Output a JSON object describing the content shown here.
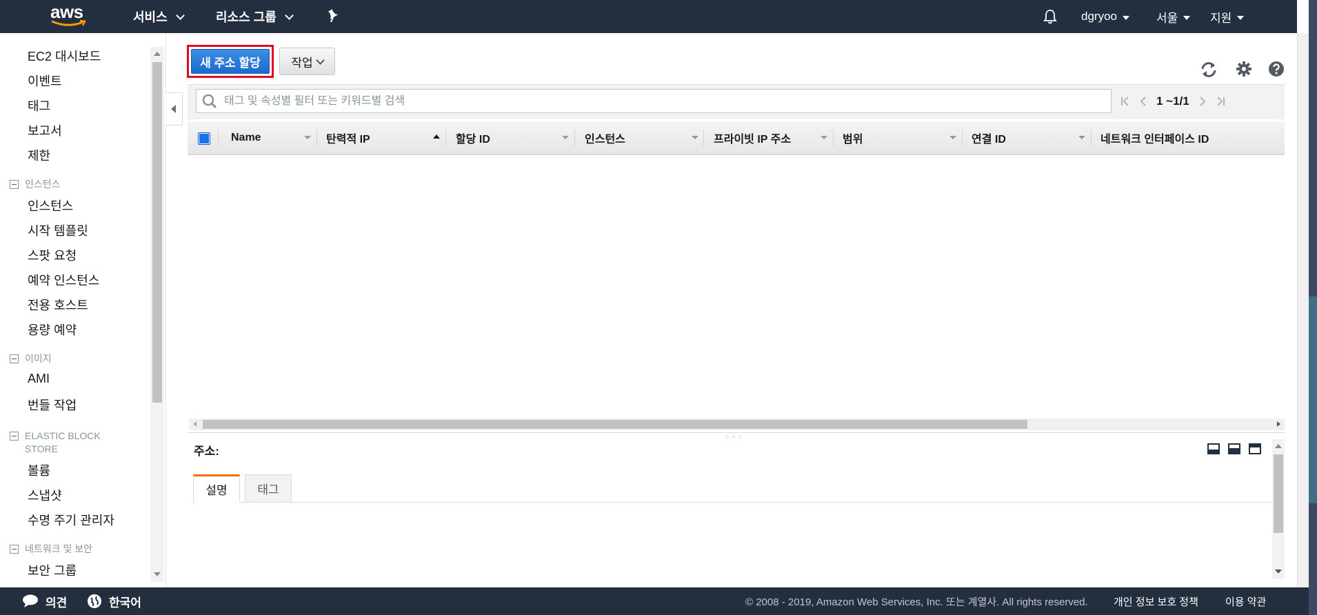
{
  "topnav": {
    "logo": "aws",
    "services": "서비스",
    "resource_groups": "리소스 그룹",
    "pin_icon": "pin-icon",
    "bell_icon": "bell-icon",
    "user": "dgryoo",
    "region": "서울",
    "support": "지원"
  },
  "sidebar": {
    "links_top": [
      "EC2 대시보드",
      "이벤트",
      "태그",
      "보고서",
      "제한"
    ],
    "sections": [
      {
        "title": "인스턴스",
        "items": [
          "인스턴스",
          "시작 템플릿",
          "스팟 요청",
          "예약 인스턴스",
          "전용 호스트",
          "용량 예약"
        ]
      },
      {
        "title": "이미지",
        "items": [
          "AMI",
          "번들 작업"
        ]
      },
      {
        "title": "ELASTIC BLOCK STORE",
        "items": [
          "볼륨",
          "스냅샷",
          "수명 주기 관리자"
        ]
      },
      {
        "title": "네트워크 및 보안",
        "items": [
          "보안 그룹"
        ]
      }
    ]
  },
  "toolbar": {
    "allocate_label": "새 주소 할당",
    "actions_label": "작업",
    "icons": [
      "refresh-icon",
      "gear-icon",
      "help-icon"
    ]
  },
  "filter": {
    "placeholder": "태그 및 속성별 필터 또는 키워드별 검색",
    "pager_count": "1 ~1/1"
  },
  "table": {
    "columns": [
      "Name",
      "탄력적 IP",
      "할당 ID",
      "인스턴스",
      "프라이빗 IP 주소",
      "범위",
      "연결 ID",
      "네트워크 인터페이스 ID"
    ],
    "sorted_column": "탄력적 IP",
    "rows": []
  },
  "details": {
    "title": "주소:",
    "tabs": [
      "설명",
      "태그"
    ],
    "active_tab": "설명"
  },
  "footer": {
    "feedback": "의견",
    "language": "한국어",
    "copyright": "© 2008 - 2019, Amazon Web Services, Inc. 또는 계열사. All rights reserved.",
    "privacy": "개인 정보 보호 정책",
    "terms": "이용 약관"
  },
  "colors": {
    "nav_bg": "#232f3e",
    "primary_button": "#1a6cce",
    "highlight_border": "#e3091c",
    "active_tab_accent": "#ec7211"
  }
}
